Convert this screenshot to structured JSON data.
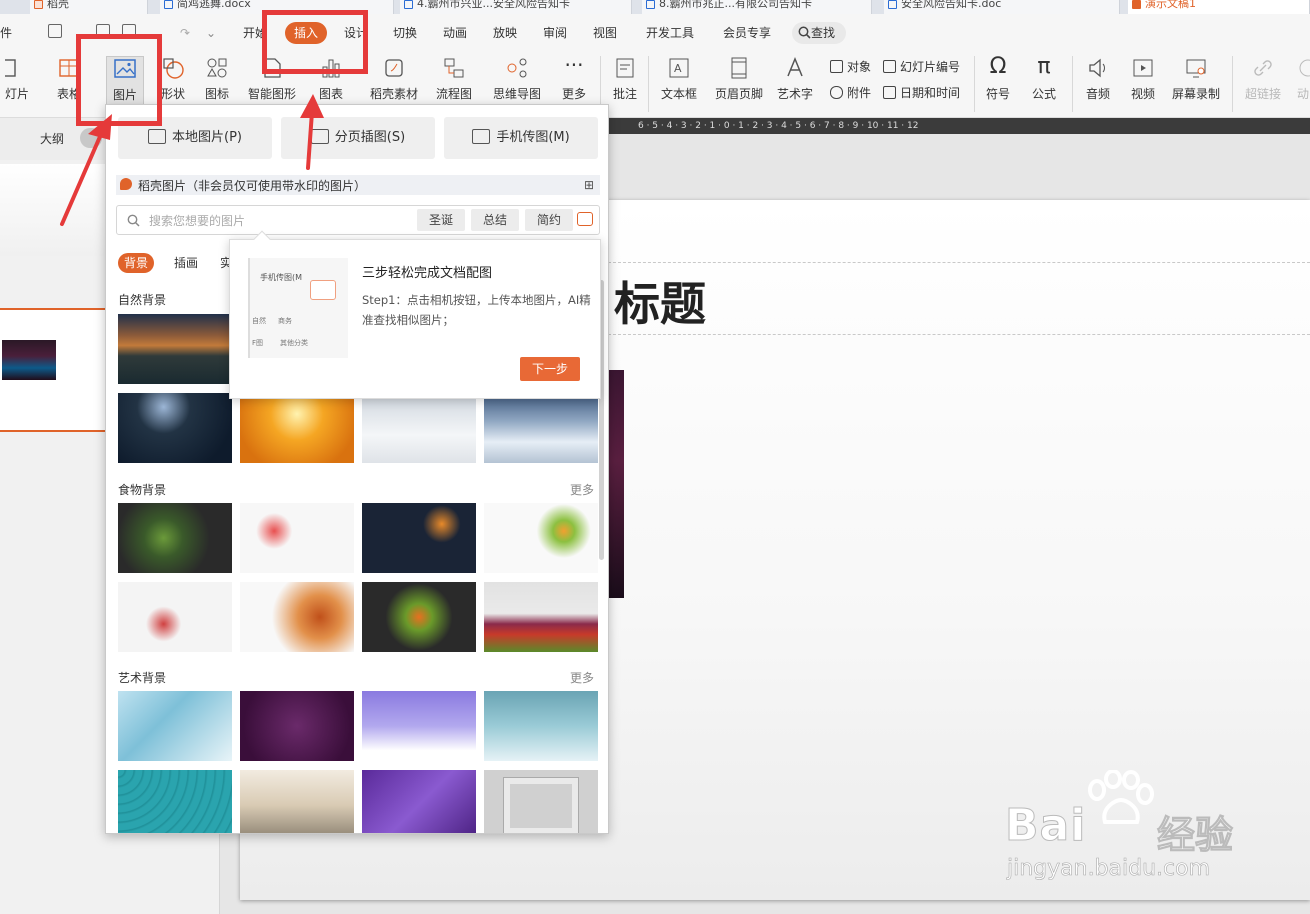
{
  "tabs": [
    {
      "label": "稻壳",
      "type": "wps"
    },
    {
      "label": "简鸡逃舞.docx",
      "type": "doc"
    },
    {
      "label": "4.霸州市兴业...安全风险告知卡",
      "type": "doc"
    },
    {
      "label": "8.霸州市兆正...有限公司告知卡",
      "type": "doc"
    },
    {
      "label": "安全风险告知卡.doc",
      "type": "doc"
    },
    {
      "label": "演示文稿1",
      "type": "ppt"
    }
  ],
  "menu": {
    "file": "件",
    "items": [
      "开始",
      "插入",
      "设计",
      "切换",
      "动画",
      "放映",
      "审阅",
      "视图",
      "开发工具",
      "会员专享"
    ],
    "active": "插入",
    "find": "查找"
  },
  "ribbon": {
    "slide": "灯片",
    "table": "表格",
    "picture": "图片",
    "shape": "形状",
    "icon": "图标",
    "smartart": "智能图形",
    "chart": "图表",
    "docer": "稻壳素材",
    "flow": "流程图",
    "mind": "思维导图",
    "more": "更多",
    "comment": "批注",
    "textbox": "文本框",
    "header": "页眉页脚",
    "wordart": "艺术字",
    "object": "对象",
    "attach": "附件",
    "slideno": "幻灯片编号",
    "datetime": "日期和时间",
    "symbol": "符号",
    "formula": "公式",
    "audio": "音频",
    "video": "视频",
    "screenrec": "屏幕录制",
    "hyperlink": "超链接",
    "action": "动"
  },
  "left": {
    "outline": "大纲"
  },
  "ruler": "6 · 5 · 4 · 3 · 2 · 1 · 0 · 1 · 2 · 3 · 4 · 5 · 6 · 7 · 8 · 9 · 10 · 11 · 12",
  "slide": {
    "title": "标题"
  },
  "panel": {
    "local": "本地图片(P)",
    "paged": "分页插图(S)",
    "phone": "手机传图(M)",
    "header": "稻壳图片（非会员仅可使用带水印的图片）",
    "search_placeholder": "搜索您想要的图片",
    "chips": [
      "圣诞",
      "总结",
      "简约"
    ],
    "cats": [
      "背景",
      "插画",
      "实"
    ],
    "sections": {
      "nature": "自然背景",
      "food": "食物背景",
      "art": "艺术背景",
      "more": "更多"
    }
  },
  "tooltip": {
    "title": "三步轻松完成文档配图",
    "body": "Step1：点击相机按钮，上传本地图片，AI精准查找相似图片；",
    "next": "下一步",
    "mini": [
      "手机传图(M",
      "自然",
      "商务",
      "F图",
      "其他分类"
    ]
  },
  "watermark": {
    "brand": "Bai",
    "brand2": "经验",
    "url": "jingyan.baidu.com"
  },
  "colors": {
    "accent": "#e0632a",
    "annotation": "#e53a3a"
  }
}
